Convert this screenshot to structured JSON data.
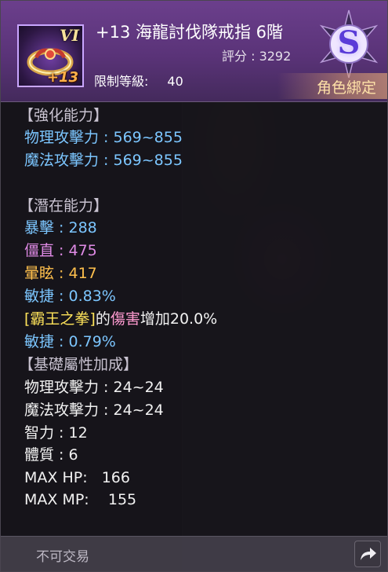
{
  "item": {
    "grade_label": "VI",
    "enhance_label": "+13",
    "name": "+13 海龍討伐隊戒指 6階",
    "score_label": "評分",
    "score_value": "3292",
    "score_text": "評分 : 3292",
    "rank_letter": "S",
    "level_label": "限制等級:",
    "level_value": "40",
    "bind_status": "角色綁定"
  },
  "sections": {
    "enhance": {
      "title": "【強化能力】",
      "lines": [
        "物理攻擊力 : 569~855",
        "魔法攻擊力 : 569~855"
      ]
    },
    "potential": {
      "title": "【潛在能力】",
      "lines": [
        "暴擊 : 288",
        "僵直 : 475",
        "暈眩 : 417",
        "敏捷 : 0.83%",
        "敏捷 : 0.79%"
      ],
      "skill_line": {
        "skill": "[霸王之拳]",
        "part1": "的",
        "part2": "傷害",
        "part3": "增加20.0%"
      }
    },
    "base": {
      "title": "【基礎屬性加成】",
      "lines": [
        "物理攻擊力 : 24~24",
        "魔法攻擊力 : 24~24",
        "智力 : 12",
        "體質 : 6",
        "MAX HP:   166",
        "MAX MP:    155"
      ]
    }
  },
  "footer": {
    "trade_status": "不可交易",
    "share_icon": "share-arrow-icon"
  },
  "colors": {
    "header_purple": "#5a3378",
    "stat_blue": "#7cc6ff",
    "stat_magenta": "#e08be6",
    "stat_gold": "#ffc04d",
    "skill_yellow": "#ffe45a",
    "bind_text": "#ffe2a8"
  }
}
